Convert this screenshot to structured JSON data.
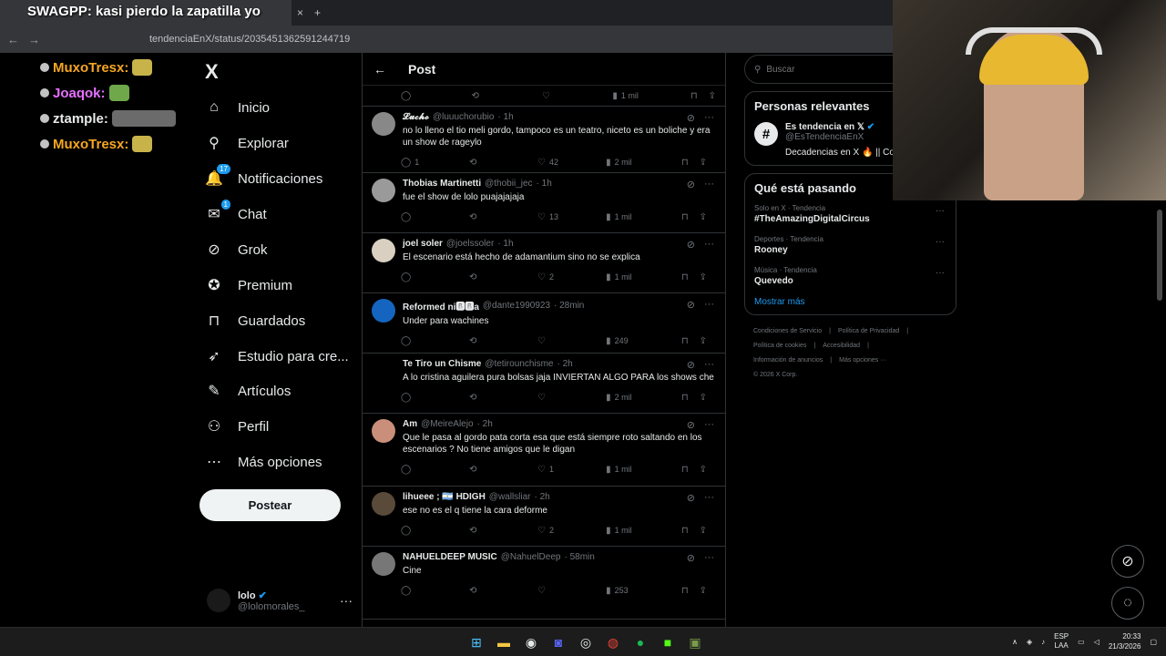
{
  "browser": {
    "tabs": [
      {
        "label": "SWAGPP: kasi pierdo la zapatilla yo"
      }
    ],
    "new_tab": "+",
    "close": "×",
    "url": "tendenciaEnX/status/2035451362591244719"
  },
  "stream_title": "SWAGPP: kasi pierdo la zapatilla yo",
  "chat": [
    {
      "user": "MuxoTresx:",
      "color": "#f5a623"
    },
    {
      "user": "Joaqok:",
      "color": "#e76fff"
    },
    {
      "user": "ztample:",
      "color": "#e7e9ea"
    },
    {
      "user": "MuxoTresx:",
      "color": "#f5a623"
    }
  ],
  "nav": {
    "logo": "X",
    "items": [
      {
        "label": "Inicio",
        "icon": "home-icon",
        "glyph": "⌂"
      },
      {
        "label": "Explorar",
        "icon": "search-icon",
        "glyph": "⚲"
      },
      {
        "label": "Notificaciones",
        "icon": "bell-icon",
        "glyph": "🔔",
        "badge": "17"
      },
      {
        "label": "Chat",
        "icon": "mail-icon",
        "glyph": "✉",
        "badge": "1"
      },
      {
        "label": "Grok",
        "icon": "grok-icon",
        "glyph": "⊘"
      },
      {
        "label": "Premium",
        "icon": "premium-icon",
        "glyph": "✪"
      },
      {
        "label": "Guardados",
        "icon": "bookmark-icon",
        "glyph": "⊓"
      },
      {
        "label": "Estudio para cre...",
        "icon": "rocket-icon",
        "glyph": "➶"
      },
      {
        "label": "Artículos",
        "icon": "article-icon",
        "glyph": "✎"
      },
      {
        "label": "Perfil",
        "icon": "person-icon",
        "glyph": "⚇"
      },
      {
        "label": "Más opciones",
        "icon": "more-circle-icon",
        "glyph": "⋯"
      }
    ],
    "post_button": "Postear",
    "profile": {
      "name": "lolo",
      "handle": "@lolomorales_",
      "more": "···"
    }
  },
  "main": {
    "title": "Post",
    "top_views": "1 mil",
    "replies": [
      {
        "name": "𝓛𝓾𝓬𝓱𝓸",
        "handle": "@luuuchorubio",
        "time": "· 1h",
        "text": "no lo lleno el tio meli gordo, tampoco es un teatro, niceto es un boliche y era un show de rageylo",
        "replies": "1",
        "likes": "42",
        "views": "2 mil",
        "avatar": "#888"
      },
      {
        "name": "Thobias Martinetti",
        "handle": "@thobii_jec",
        "time": "· 1h",
        "text": "fue el show de lolo puajajajaja",
        "replies": "",
        "likes": "13",
        "views": "1 mil",
        "avatar": "#9a9a9a"
      },
      {
        "name": "joel soler",
        "handle": "@joelssoler",
        "time": "· 1h",
        "text": "El escenario está hecho de adamantium sino no se explica",
        "replies": "",
        "likes": "2",
        "views": "1 mil",
        "avatar": "#d9d0c2"
      },
      {
        "name": "Reformed ni🅱🅱a",
        "handle": "@dante1990923",
        "time": "· 28min",
        "text": "Under para wachines",
        "replies": "",
        "likes": "",
        "views": "249",
        "avatar": "#1565c0"
      },
      {
        "name": "Te Tiro un Chisme",
        "handle": "@tetirounchisme",
        "time": "· 2h",
        "text": "A lo cristina aguilera pura bolsas jaja INVIERTAN ALGO PARA los shows che",
        "replies": "",
        "likes": "",
        "views": "2 mil",
        "avatar": "#000"
      },
      {
        "name": "Am",
        "handle": "@MeireAlejo",
        "time": "· 2h",
        "text": "Que le pasa al gordo pata corta esa que está siempre roto saltando en los escenarios ? No tiene amigos que le digan",
        "replies": "",
        "likes": "1",
        "views": "1 mil",
        "avatar": "#c98f7a"
      },
      {
        "name": "lihueee ; 🇦🇷 HDIGH",
        "handle": "@wallsliar",
        "time": "· 2h",
        "text": "ese no es el q tiene la cara deforme",
        "replies": "",
        "likes": "2",
        "views": "1 mil",
        "avatar": "#5a4a3a"
      },
      {
        "name": "NAHUELDEEP MUSIC",
        "handle": "@NahuelDeep",
        "time": "· 58min",
        "text": "Cine",
        "replies": "",
        "likes": "",
        "views": "253",
        "avatar": "#777"
      }
    ]
  },
  "right": {
    "search_placeholder": "Buscar",
    "relevant": {
      "title": "Personas relevantes",
      "name": "Es tendencia en 𝕏",
      "handle": "@EsTendenciaEnX",
      "bio": "Decadencias en X 🔥 || Co"
    },
    "trends": {
      "title": "Qué está pasando",
      "items": [
        {
          "category": "Solo en X · Tendencia",
          "name": "#TheAmazingDigitalCircus"
        },
        {
          "category": "Deportes · Tendencia",
          "name": "Rooney"
        },
        {
          "category": "Música · Tendencia",
          "name": "Quevedo"
        }
      ],
      "more": "···",
      "show_more": "Mostrar más"
    },
    "footer": [
      "Condiciones de Servicio",
      "|",
      "Política de Privacidad",
      "|",
      "Política de cookies",
      "|",
      "Accesibilidad",
      "|",
      "Información de anuncios",
      "|",
      "Más opciones ···",
      "© 2026 X Corp."
    ]
  },
  "taskbar": {
    "lang_top": "ESP",
    "lang_bottom": "LAA",
    "time": "20:33",
    "date": "21/3/2026"
  }
}
